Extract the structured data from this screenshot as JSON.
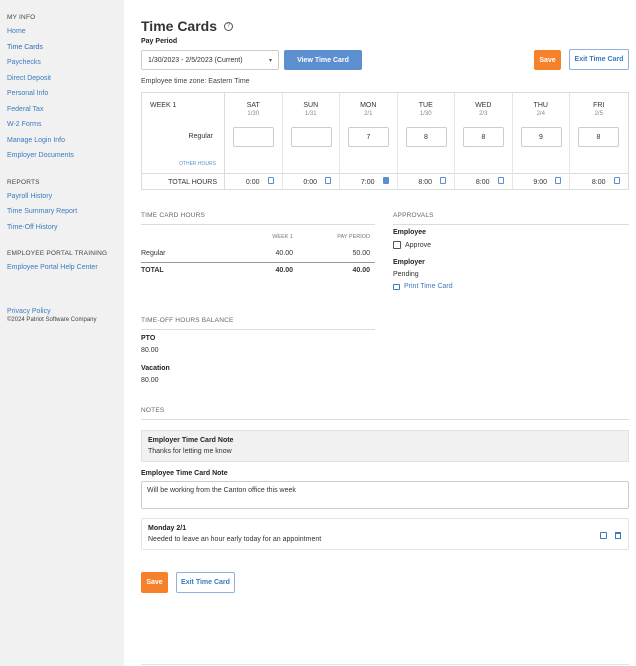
{
  "sidebar": {
    "my_info": "MY INFO",
    "items": [
      "Home",
      "Time Cards",
      "Paychecks",
      "Direct Deposit",
      "Personal Info",
      "Federal Tax",
      "W-2 Forms",
      "Manage Login Info",
      "Employer Documents"
    ],
    "reports": "REPORTS",
    "report_items": [
      "Payroll History",
      "Time Summary Report",
      "Time-Off History"
    ],
    "training": "EMPLOYEE PORTAL TRAINING",
    "training_items": [
      "Employee Portal Help Center"
    ],
    "privacy": "Privacy Policy",
    "copyright": "©2024 Patriot Software Company"
  },
  "header": {
    "title": "Time Cards",
    "pay_period_label": "Pay Period",
    "pay_period_value": "1/30/2023 - 2/5/2023 (Current)",
    "view_button": "View Time Card",
    "save_button": "Save",
    "exit_button": "Exit Time Card",
    "timezone": "Employee time zone: Eastern Time"
  },
  "grid": {
    "week_label": "WEEK 1",
    "regular_label": "Regular",
    "other_hours": "OTHER HOURS",
    "total_label": "TOTAL HOURS",
    "days": [
      {
        "name": "SAT",
        "date": "1/30",
        "value": "",
        "total": "0:00"
      },
      {
        "name": "SUN",
        "date": "1/31",
        "value": "",
        "total": "0:00"
      },
      {
        "name": "MON",
        "date": "2/1",
        "value": "7",
        "total": "7:00"
      },
      {
        "name": "TUE",
        "date": "1/30",
        "value": "8",
        "total": "8:00"
      },
      {
        "name": "WED",
        "date": "2/3",
        "value": "8",
        "total": "8:00"
      },
      {
        "name": "THU",
        "date": "2/4",
        "value": "9",
        "total": "9:00"
      },
      {
        "name": "FRI",
        "date": "2/5",
        "value": "8",
        "total": "8:00"
      }
    ]
  },
  "hours": {
    "heading": "TIME CARD HOURS",
    "col_week": "WEEK 1",
    "col_period": "PAY PERIOD",
    "rows": [
      {
        "label": "Regular",
        "week": "40.00",
        "period": "50.00"
      },
      {
        "label": "TOTAL",
        "week": "40.00",
        "period": "40.00"
      }
    ]
  },
  "approvals": {
    "heading": "APPROVALS",
    "employee_label": "Employee",
    "approve_label": "Approve",
    "employer_label": "Employer",
    "employer_status": "Pending",
    "print_link": "Print Time Card"
  },
  "balance": {
    "heading": "TIME-OFF HOURS BALANCE",
    "items": [
      {
        "label": "PTO",
        "value": "80.00"
      },
      {
        "label": "Vacation",
        "value": "80.00"
      }
    ]
  },
  "notes": {
    "heading": "NOTES",
    "employer_note_title": "Employer Time Card Note",
    "employer_note_text": "Thanks for letting me know",
    "employee_note_title": "Employee Time Card Note",
    "employee_note_text": "Will be working from the Canton office this week",
    "comment_title": "Monday 2/1",
    "comment_text": "Needed to leave an hour early today for an appointment"
  },
  "footer": {
    "save_button": "Save",
    "exit_button": "Exit Time Card"
  }
}
